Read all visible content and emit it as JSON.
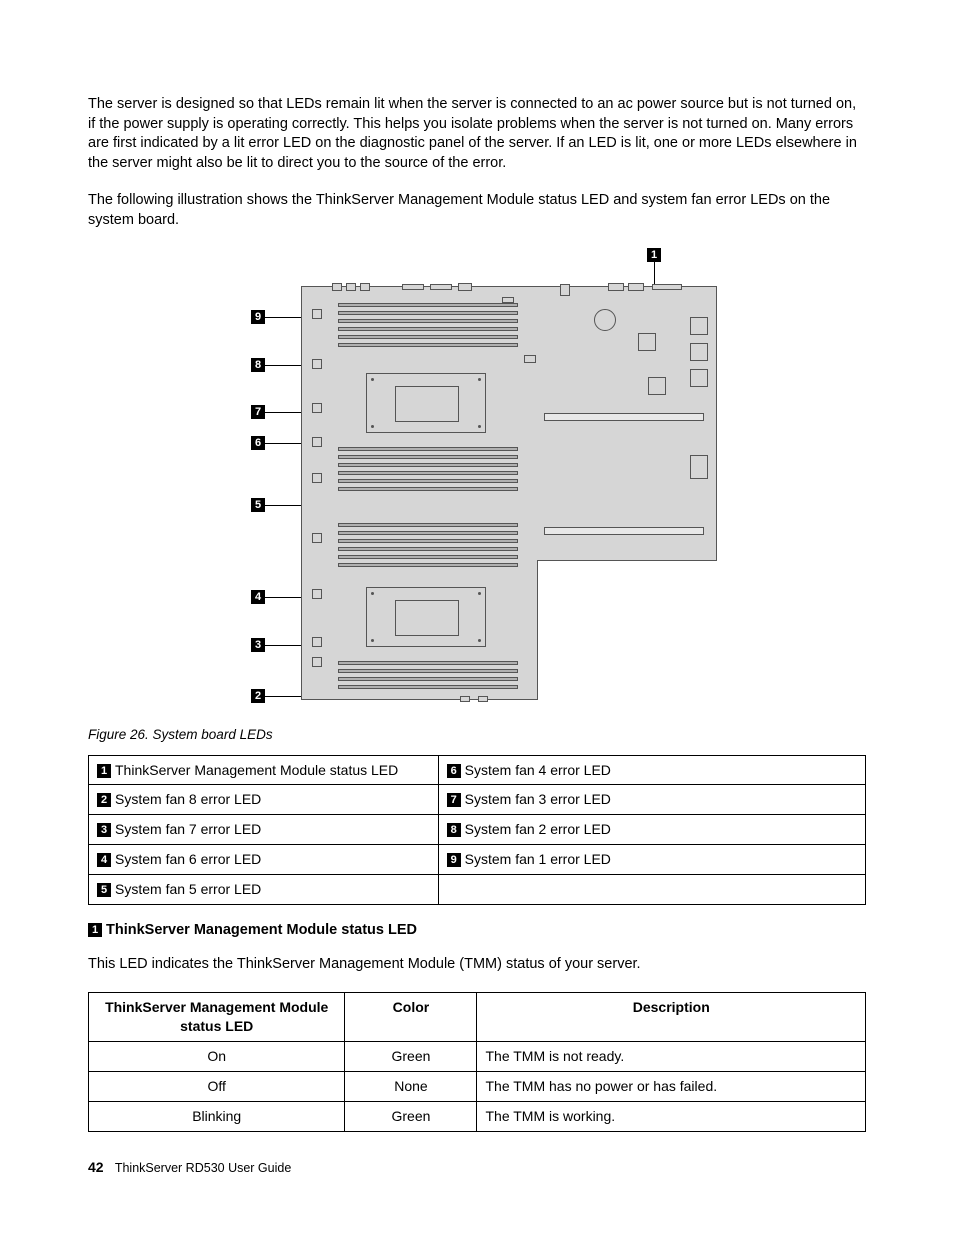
{
  "para1": "The server is designed so that LEDs remain lit when the server is connected to an ac power source but is not turned on, if the power supply is operating correctly. This helps you isolate problems when the server is not turned on. Many errors are first indicated by a lit error LED on the diagnostic panel of the server. If an LED is lit, one or more LEDs elsewhere in the server might also be lit to direct you to the source of the error.",
  "para2": "The following illustration shows the ThinkServer Management Module status LED and system fan error LEDs on the system board.",
  "figure_caption": "Figure 26.  System board LEDs",
  "callouts": {
    "c1": "1",
    "c2": "2",
    "c3": "3",
    "c4": "4",
    "c5": "5",
    "c6": "6",
    "c7": "7",
    "c8": "8",
    "c9": "9"
  },
  "legend": {
    "r1a_num": "1",
    "r1a": "ThinkServer Management Module status LED",
    "r1b_num": "6",
    "r1b": "System fan 4 error LED",
    "r2a_num": "2",
    "r2a": "System fan 8 error LED",
    "r2b_num": "7",
    "r2b": "System fan 3 error LED",
    "r3a_num": "3",
    "r3a": "System fan 7 error LED",
    "r3b_num": "8",
    "r3b": "System fan 2 error LED",
    "r4a_num": "4",
    "r4a": "System fan 6 error LED",
    "r4b_num": "9",
    "r4b": "System fan 1 error LED",
    "r5a_num": "5",
    "r5a": "System fan 5 error LED"
  },
  "section1": {
    "badge": "1",
    "title": "ThinkServer Management Module status LED",
    "intro": "This LED indicates the ThinkServer Management Module (TMM) status of your server."
  },
  "status_table": {
    "h1": "ThinkServer Management Module status LED",
    "h2": "Color",
    "h3": "Description",
    "rows": [
      {
        "a": "On",
        "b": "Green",
        "c": "The TMM is not ready."
      },
      {
        "a": "Off",
        "b": "None",
        "c": "The TMM has no power or has failed."
      },
      {
        "a": "Blinking",
        "b": "Green",
        "c": "The TMM is working."
      }
    ]
  },
  "footer": {
    "page": "42",
    "title": "ThinkServer RD530 User Guide"
  }
}
